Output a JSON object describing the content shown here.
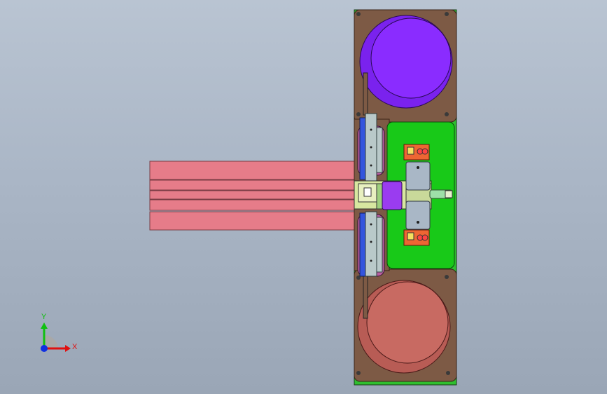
{
  "viewport": {
    "background_top": "#b9c4d2",
    "background_bottom": "#9aa6b6"
  },
  "model": {
    "colors": {
      "base_plate": "#7d5a45",
      "green_plate": "#18c918",
      "reel_top": "#8a22ff",
      "reel_bottom": "#c86a62",
      "conveyor": "#e67c89",
      "slide_blue": "#3355dd",
      "slide_grey": "#b9c9c9",
      "purple_block": "#9a3cf0",
      "orange_block": "#ee6633",
      "grey_block": "#a9b7c6",
      "yellow_block": "#d7e7a0"
    }
  },
  "triad": {
    "x_label": "X",
    "y_label": "Y",
    "x_color": "#e01010",
    "y_color": "#10c010",
    "z_color": "#1030e0"
  }
}
